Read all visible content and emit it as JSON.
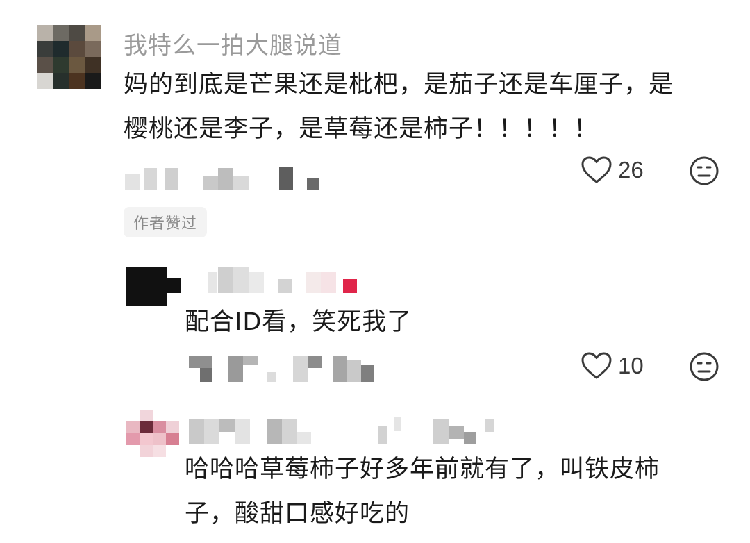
{
  "comments": [
    {
      "username": "我特么一拍大腿说道",
      "content_lines": [
        "妈的到底是芒果还是枇杷，是茄子还是车厘子，是",
        "樱桃还是李子，是草莓还是柿子！！！！！"
      ],
      "likes": "26",
      "badge": "作者赞过"
    },
    {
      "content_lines": [
        "配合ID看，笑死我了"
      ],
      "likes": "10"
    },
    {
      "content_lines": [
        "哈哈哈草莓柿子好多年前就有了，叫铁皮柿",
        "子，酸甜口感好吃的"
      ]
    }
  ],
  "icons": {
    "like": "heart-icon",
    "dislike": "frown-icon"
  },
  "colors": {
    "username": "#9a9a9a",
    "text": "#1a1a1a",
    "badge_bg": "#f3f3f3"
  }
}
